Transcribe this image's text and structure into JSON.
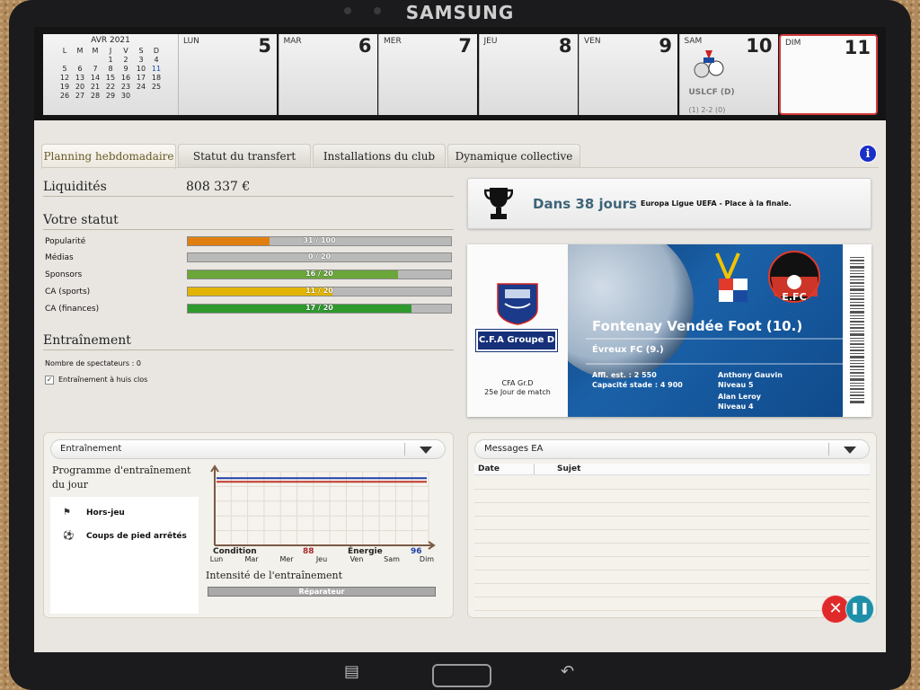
{
  "device": {
    "brand": "SAMSUNG"
  },
  "calendar": {
    "mini": {
      "title": "AVR 2021",
      "weekdays": [
        "L",
        "M",
        "M",
        "J",
        "V",
        "S",
        "D"
      ],
      "rows": [
        [
          "",
          "",
          "",
          "1",
          "2",
          "3",
          "4"
        ],
        [
          "5",
          "6",
          "7",
          "8",
          "9",
          "10",
          "11"
        ],
        [
          "12",
          "13",
          "14",
          "15",
          "16",
          "17",
          "18"
        ],
        [
          "19",
          "20",
          "21",
          "22",
          "23",
          "24",
          "25"
        ],
        [
          "26",
          "27",
          "28",
          "29",
          "30",
          "",
          ""
        ]
      ]
    },
    "days": [
      {
        "name": "LUN",
        "num": "5"
      },
      {
        "name": "MAR",
        "num": "6"
      },
      {
        "name": "MER",
        "num": "7"
      },
      {
        "name": "JEU",
        "num": "8"
      },
      {
        "name": "VEN",
        "num": "9"
      },
      {
        "name": "SAM",
        "num": "10",
        "match": "USLCF (D)",
        "score": "(1) 2-2 (0)"
      },
      {
        "name": "DIM",
        "num": "11"
      }
    ]
  },
  "tabs": [
    {
      "label": "Planning hebdomadaire"
    },
    {
      "label": "Statut du transfert"
    },
    {
      "label": "Installations du club"
    },
    {
      "label": "Dynamique collective"
    }
  ],
  "info_label": "i",
  "finance": {
    "title": "Liquidités",
    "value": "808 337 €"
  },
  "status": {
    "title": "Votre statut",
    "items": [
      {
        "label": "Popularité",
        "value": 31,
        "max": 100,
        "text": "31 / 100",
        "color": "#e07f10"
      },
      {
        "label": "Médias",
        "value": 0,
        "max": 20,
        "text": "0 / 20",
        "color": "#6aa63a"
      },
      {
        "label": "Sponsors",
        "value": 16,
        "max": 20,
        "text": "16 / 20",
        "color": "#6aa63a"
      },
      {
        "label": "CA (sports)",
        "value": 11,
        "max": 20,
        "text": "11 / 20",
        "color": "#e2b400"
      },
      {
        "label": "CA (finances)",
        "value": 17,
        "max": 20,
        "text": "17 / 20",
        "color": "#2e9a2e"
      }
    ]
  },
  "training": {
    "title": "Entraînement",
    "spectators": "Nombre de spectateurs : 0",
    "closed_label": "Entraînement à huis clos",
    "closed_checked": "✓"
  },
  "competition": {
    "days": "Dans 38 jours",
    "desc": "Europa Ligue UEFA - Place à la finale."
  },
  "match": {
    "league": "C.F.A Groupe D",
    "division": "CFA Gr.D",
    "matchday": "25e Jour de match",
    "home": "Fontenay Vendée Foot (10.)",
    "away": "Évreux FC (9.)",
    "attendance": "Affl. est. : 2 550",
    "capacity": "Capacité stade : 4 900",
    "referee1": "Anthony Gauvin",
    "referee1_level": "Niveau 5",
    "referee2": "Alan Leroy",
    "referee2_level": "Niveau 4"
  },
  "training_panel": {
    "dropdown": "Entraînement",
    "program_title": "Programme d'entraînement du jour",
    "drills": [
      {
        "label": "Hors-jeu",
        "icon": "offside-icon"
      },
      {
        "label": "Coups de pied arrêtés",
        "icon": "ball-icon"
      }
    ],
    "condition_label": "Condition",
    "condition_value": "88",
    "energy_label": "Énergie",
    "energy_value": "96",
    "intensity_title": "Intensité de l'entraînement",
    "intensity_value": "Réparateur"
  },
  "chart_data": {
    "type": "line",
    "categories": [
      "Lun",
      "Mar",
      "Mer",
      "Jeu",
      "Ven",
      "Sam",
      "Dim"
    ],
    "series": [
      {
        "name": "Condition",
        "values": [
          88,
          88,
          88,
          88,
          88,
          88,
          88
        ],
        "color": "#c0392b"
      },
      {
        "name": "Énergie",
        "values": [
          96,
          96,
          96,
          96,
          96,
          96,
          96
        ],
        "color": "#1f3fa6"
      }
    ],
    "ylim": [
      0,
      100
    ]
  },
  "messages": {
    "dropdown": "Messages EA",
    "col_date": "Date",
    "col_subject": "Sujet"
  },
  "controls": {
    "close": "✕",
    "pause": "❚❚"
  },
  "nav": {
    "recent": "▤",
    "back": "↶"
  }
}
